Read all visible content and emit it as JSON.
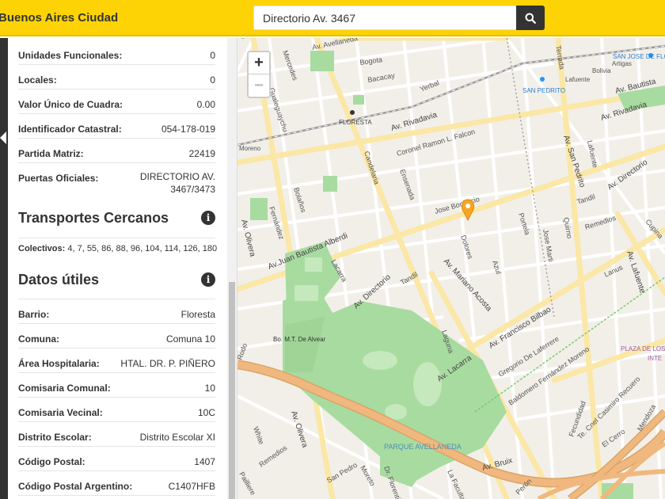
{
  "header": {
    "brand": "Buenos Aires Ciudad",
    "search_value": "Directorio Av. 3467"
  },
  "parcel": [
    {
      "label": "Unidades Funcionales:",
      "value": "0"
    },
    {
      "label": "Locales:",
      "value": "0"
    },
    {
      "label": "Valor Único de Cuadra:",
      "value": "0.00"
    },
    {
      "label": "Identificador Catastral:",
      "value": "054-178-019"
    },
    {
      "label": "Partida Matriz:",
      "value": "22419"
    },
    {
      "label": "Puertas Oficiales:",
      "value": "DIRECTORIO AV. 3467/3473"
    }
  ],
  "transport": {
    "title": "Transportes Cercanos",
    "label": "Colectivos:",
    "value": "4, 7, 55, 86, 88, 96, 104, 114, 126, 180"
  },
  "useful": {
    "title": "Datos útiles",
    "items": [
      {
        "label": "Barrio:",
        "value": "Floresta"
      },
      {
        "label": "Comuna:",
        "value": "Comuna 10"
      },
      {
        "label": "Área Hospitalaria:",
        "value": "HTAL. DR. P. PIÑERO"
      },
      {
        "label": "Comisaria Comunal:",
        "value": "10"
      },
      {
        "label": "Comisaria Vecinal:",
        "value": "10C"
      },
      {
        "label": "Distrito Escolar:",
        "value": "Distrito Escolar XI"
      },
      {
        "label": "Código Postal:",
        "value": "1407"
      },
      {
        "label": "Código Postal Argentino:",
        "value": "C1407HFB"
      }
    ]
  },
  "map": {
    "zoom_in": "+",
    "zoom_out": "−",
    "labels": {
      "avellaneda": "Av. Avellaneda",
      "bogota": "Bogota",
      "bacacay": "Bacacay",
      "yerbal": "Yerbal",
      "mercedes": "Mercedes",
      "gualeguaychu": "Gualeguaychu",
      "floresta": "FLORESTA",
      "rivadavia": "Av. Rivadavia",
      "rivadavia2": "Av. Rivadavia",
      "coronel": "Coronel Ramon L. Falcon",
      "moreno": "Moreno",
      "candelaria": "Candelaria",
      "ensenada": "Ensenada",
      "bolanos": "Bolaños",
      "fernandez": "Fernández",
      "olivera": "Av. Olivera",
      "olivera2": "Av. Olivera",
      "alberdi": "Av.Juan Bautista Alberdi",
      "bonifacio": "Jose Bonifacio",
      "dolores": "Dolores",
      "lacarra": "Lacarra",
      "lacarra2": "Av. Lacarra",
      "directorio": "Av. Directorio",
      "directorio2": "Av. Directorio",
      "tandil": "Tandil",
      "tandil2": "Tandil",
      "mariano": "Av. Mariano Acosta",
      "azul": "Azul",
      "portela": "Portela",
      "jose_marti": "Jose Marti",
      "quirno": "Quirno",
      "sanpedrito": "Av. San Pedrito",
      "sanpedrito_st": "SAN PEDRITO",
      "lafuente": "Lafuente",
      "lafuente2": "Lafuente",
      "lafuente_av": "Av. Lafuente",
      "terrada": "Terrada",
      "bolivia": "Bolivia",
      "artigas": "Artigas",
      "sanjose": "SAN JOSE DE FLO",
      "avbautista": "Av. Bautista",
      "remedios": "Remedios",
      "remedios2": "Remedios",
      "lanus": "Lanus",
      "cupinares": "Cupina",
      "bilbao": "Av. Francisco Bilbao",
      "laguna": "Laguna",
      "laferrere": "Gregorio De Laferrere",
      "baldomero": "Baldomero Fernández Moreno",
      "plaza": "PLAZA DE LOS",
      "inte": "INTE",
      "alvear": "Bo. M.T. De Alvear",
      "rodo": "Rodo",
      "white": "White",
      "remedios3": "Remedios",
      "pailler": "Pailliere",
      "sanpedro": "San Pedro",
      "moreto": "Moreto",
      "florentino": "Dr. Florentino Am.",
      "lafuente_st": "La Facultad",
      "perón": "Perón",
      "avbruix": "Av. Bruix",
      "parque": "PARQUE AVELLANEDA",
      "fecundidad": "Fecundidad",
      "recuero": "Te. Cnel Casimiro Recuero",
      "cerro": "El Cerro",
      "mendoza": "Mendoza"
    }
  }
}
